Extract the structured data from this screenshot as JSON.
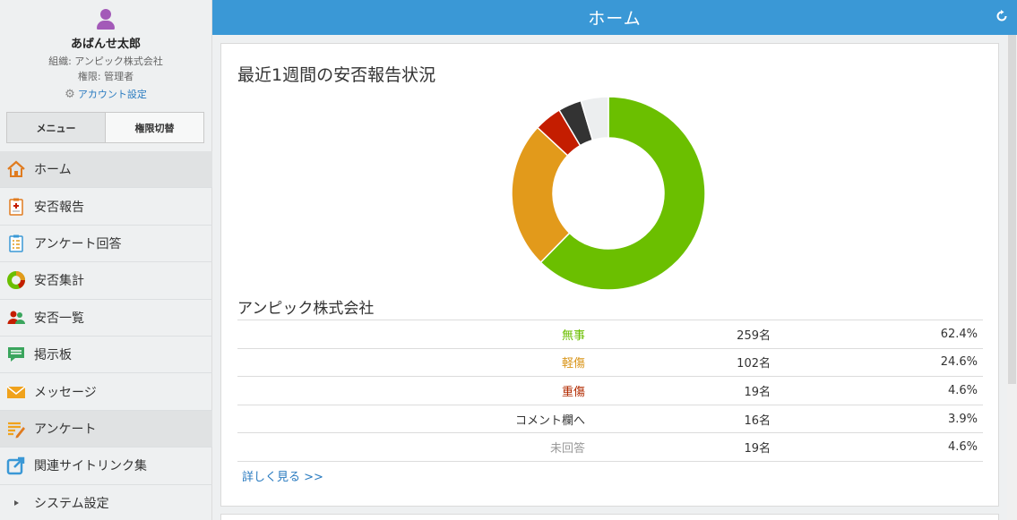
{
  "header": {
    "title": "ホーム"
  },
  "profile": {
    "name": "あばんせ太郎",
    "org": "組織: アンピック株式会社",
    "role": "権限: 管理者",
    "account_settings": "アカウント設定"
  },
  "toggle": {
    "menu": "メニュー",
    "role_switch": "権限切替"
  },
  "nav": [
    {
      "label": "ホーム",
      "icon": "home-icon"
    },
    {
      "label": "安否報告",
      "icon": "report-clipboard-icon"
    },
    {
      "label": "アンケート回答",
      "icon": "survey-answer-icon"
    },
    {
      "label": "安否集計",
      "icon": "donut-chart-icon"
    },
    {
      "label": "安否一覧",
      "icon": "users-icon"
    },
    {
      "label": "掲示板",
      "icon": "chat-bubble-icon"
    },
    {
      "label": "メッセージ",
      "icon": "envelope-icon"
    },
    {
      "label": "アンケート",
      "icon": "survey-edit-icon"
    },
    {
      "label": "関連サイトリンク集",
      "icon": "external-link-icon"
    },
    {
      "label": "システム設定",
      "icon": "triangle-right-icon"
    }
  ],
  "panel": {
    "title": "最近1週間の安否報告状況",
    "org_name": "アンピック株式会社",
    "more_link": "詳しく見る >>"
  },
  "chart_data": {
    "type": "pie",
    "style": "donut",
    "categories": [
      "無事",
      "軽傷",
      "重傷",
      "コメント欄へ",
      "未回答"
    ],
    "values": [
      62.4,
      24.6,
      4.6,
      3.9,
      4.6
    ],
    "counts": [
      259,
      102,
      19,
      16,
      19
    ],
    "colors": [
      "#6bbf00",
      "#e29a1b",
      "#c41d00",
      "#333333",
      "#eceeef"
    ]
  },
  "stats_rows": [
    {
      "label": "無事",
      "count": "259名",
      "pct": "62.4%",
      "color": "#6bbf00"
    },
    {
      "label": "軽傷",
      "count": "102名",
      "pct": "24.6%",
      "color": "#d9951a"
    },
    {
      "label": "重傷",
      "count": "19名",
      "pct": "4.6%",
      "color": "#b22a00"
    },
    {
      "label": "コメント欄へ",
      "count": "16名",
      "pct": "3.9%",
      "color": "#333333"
    },
    {
      "label": "未回答",
      "count": "19名",
      "pct": "4.6%",
      "color": "#9a9a9a"
    }
  ],
  "colors": {
    "header": "#3a98d6",
    "link": "#2a7bc0"
  }
}
